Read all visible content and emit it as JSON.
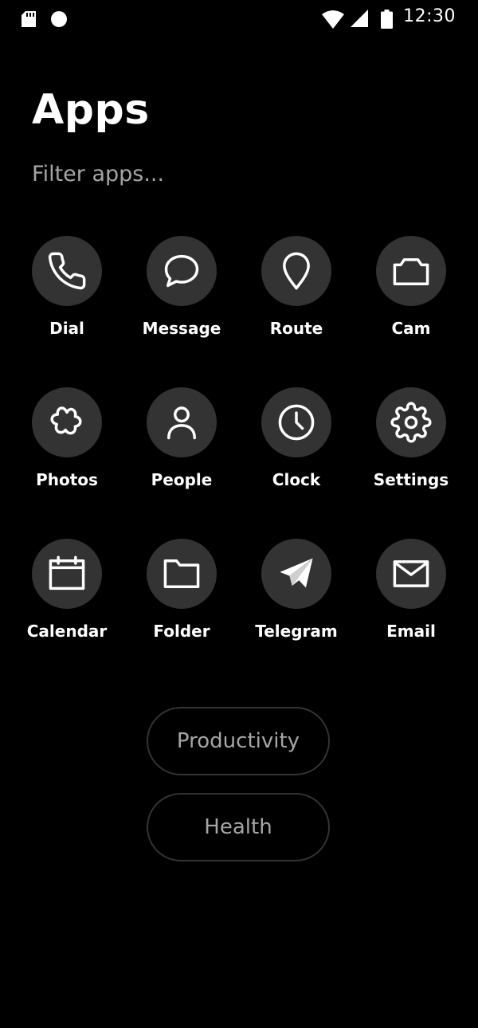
{
  "status_bar": {
    "time": "12:30",
    "left_icons": [
      "sd-card-icon",
      "dot-notification-icon"
    ],
    "right_icons": [
      "wifi-icon",
      "cellular-signal-icon",
      "battery-icon"
    ]
  },
  "header": {
    "title": "Apps"
  },
  "search": {
    "placeholder": "Filter apps...",
    "value": ""
  },
  "apps": [
    {
      "label": "Dial",
      "icon": "phone-icon"
    },
    {
      "label": "Message",
      "icon": "message-bubble-icon"
    },
    {
      "label": "Route",
      "icon": "map-pin-icon"
    },
    {
      "label": "Cam",
      "icon": "camera-icon"
    },
    {
      "label": "Photos",
      "icon": "flower-icon"
    },
    {
      "label": "People",
      "icon": "person-icon"
    },
    {
      "label": "Clock",
      "icon": "clock-icon"
    },
    {
      "label": "Settings",
      "icon": "gear-icon"
    },
    {
      "label": "Calendar",
      "icon": "calendar-icon"
    },
    {
      "label": "Folder",
      "icon": "folder-icon"
    },
    {
      "label": "Telegram",
      "icon": "telegram-paper-plane-icon"
    },
    {
      "label": "Email",
      "icon": "envelope-icon"
    }
  ],
  "categories": [
    {
      "label": "Productivity"
    },
    {
      "label": "Health"
    }
  ],
  "colors": {
    "background": "#000000",
    "icon_circle": "#333333",
    "text": "#ffffff",
    "muted_text": "#a6a6a6",
    "pill_border": "#333333"
  }
}
